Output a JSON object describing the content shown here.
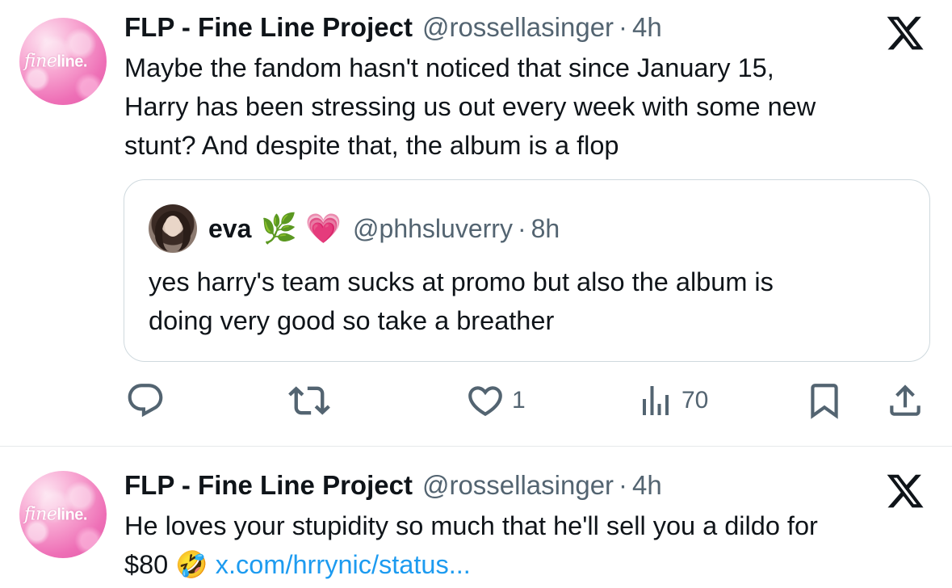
{
  "tweets": [
    {
      "author_name": "FLP - Fine Line Project",
      "handle": "@rossellasinger",
      "separator": "·",
      "time": "4h",
      "avatar_text_a": "fine",
      "avatar_text_b": "line.",
      "text_lines": [
        "Maybe the fandom hasn't noticed that since January 15,",
        "Harry has been stressing us out every week with some new",
        "stunt? And despite that, the album is a flop"
      ],
      "quote": {
        "name": "eva",
        "emojis": "🌿 💗",
        "handle": "@phhsluverry",
        "separator": "·",
        "time": "8h",
        "text_lines": [
          "yes harry's team sucks at promo but also the album is",
          "doing very good so take a breather"
        ]
      },
      "actions": {
        "reply_icon": "reply-icon",
        "retweet_icon": "retweet-icon",
        "like_icon": "heart-icon",
        "like_count": "1",
        "views_icon": "views-icon",
        "views_count": "70",
        "bookmark_icon": "bookmark-icon",
        "share_icon": "share-icon"
      }
    },
    {
      "author_name": "FLP - Fine Line Project",
      "handle": "@rossellasinger",
      "separator": "·",
      "time": "4h",
      "avatar_text_a": "fine",
      "avatar_text_b": "line.",
      "text_line_1": "He loves your stupidity so much that he'll sell you a dildo for",
      "text_line_2_prefix": "$80",
      "text_line_2_emoji": "🤣",
      "text_line_2_link": "x.com/hrrynic/status..."
    }
  ],
  "colors": {
    "text": "#0f1419",
    "secondary": "#536471",
    "link": "#1d9bf0",
    "border": "#cfd9de",
    "divider": "#e6e9eb"
  }
}
